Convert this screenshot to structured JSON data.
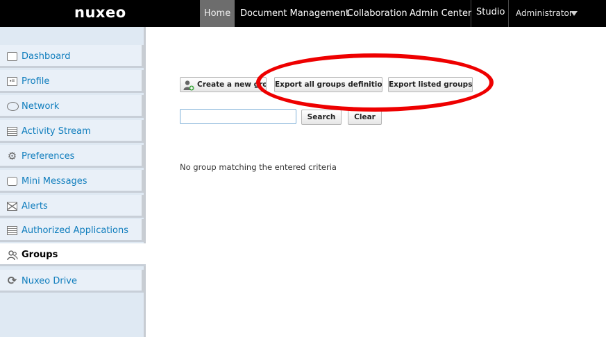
{
  "header": {
    "logo": "nuxeo",
    "nav": [
      {
        "label": "Home"
      },
      {
        "label": "Document Management"
      },
      {
        "label": "Collaboration"
      },
      {
        "label": "Admin Center"
      },
      {
        "label": "Studio"
      }
    ],
    "user": "Administrator"
  },
  "sidebar": {
    "items": [
      {
        "label": "Dashboard",
        "icon": "dashboard-icon"
      },
      {
        "label": "Profile",
        "icon": "profile-card-icon"
      },
      {
        "label": "Network",
        "icon": "network-rings-icon"
      },
      {
        "label": "Activity Stream",
        "icon": "activity-stream-icon"
      },
      {
        "label": "Preferences",
        "icon": "gear-icon"
      },
      {
        "label": "Mini Messages",
        "icon": "speech-bubble-icon"
      },
      {
        "label": "Alerts",
        "icon": "envelope-icon"
      },
      {
        "label": "Authorized Applications",
        "icon": "list-icon"
      },
      {
        "label": "Groups",
        "icon": "group-users-icon"
      },
      {
        "label": "Nuxeo Drive",
        "icon": "sync-icon"
      }
    ],
    "active": "Groups"
  },
  "main": {
    "create_label": "Create a new group",
    "export_all_label": "Export all groups definition",
    "export_listed_label": "Export listed groups",
    "search_value": "",
    "search_label": "Search",
    "clear_label": "Clear",
    "empty_message": "No group matching the entered criteria"
  },
  "colors": {
    "topbar": "#000000",
    "active_nav": "#6d6d6d",
    "sidebar_bg": "#e9f0f8",
    "link": "#0f7dbd",
    "highlight": "#ee0000"
  }
}
